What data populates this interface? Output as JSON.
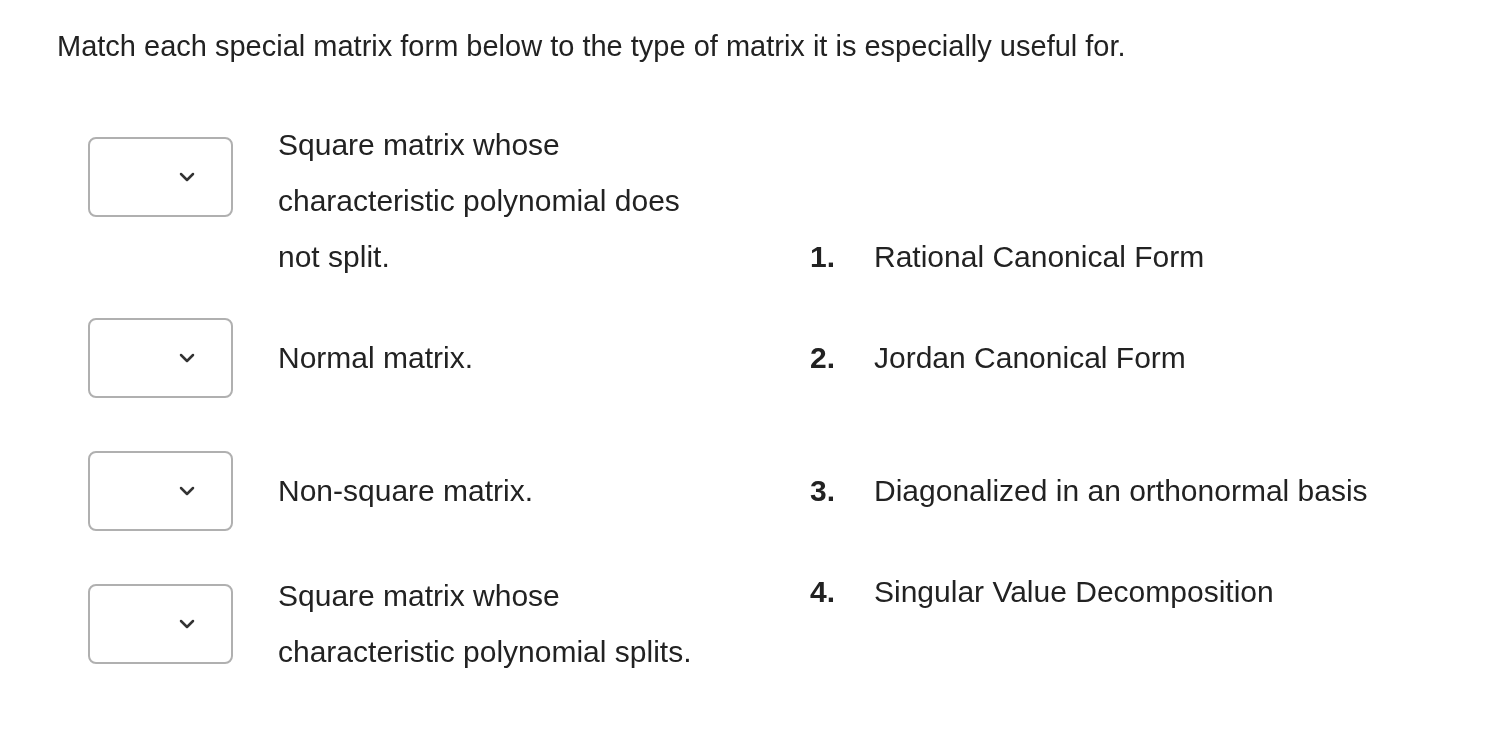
{
  "question": "Match each special matrix form below to the type of matrix it is especially useful for.",
  "prompts": [
    {
      "text": "Square matrix whose characteristic polynomial does not split."
    },
    {
      "text": "Normal matrix."
    },
    {
      "text": "Non-square matrix."
    },
    {
      "text": "Square matrix whose characteristic polynomial splits."
    }
  ],
  "options": [
    {
      "number": "1.",
      "text": "Rational Canonical Form"
    },
    {
      "number": "2.",
      "text": "Jordan Canonical Form"
    },
    {
      "number": "3.",
      "text": "Diagonalized in an orthonormal basis"
    },
    {
      "number": "4.",
      "text": "Singular Value Decomposition"
    }
  ]
}
